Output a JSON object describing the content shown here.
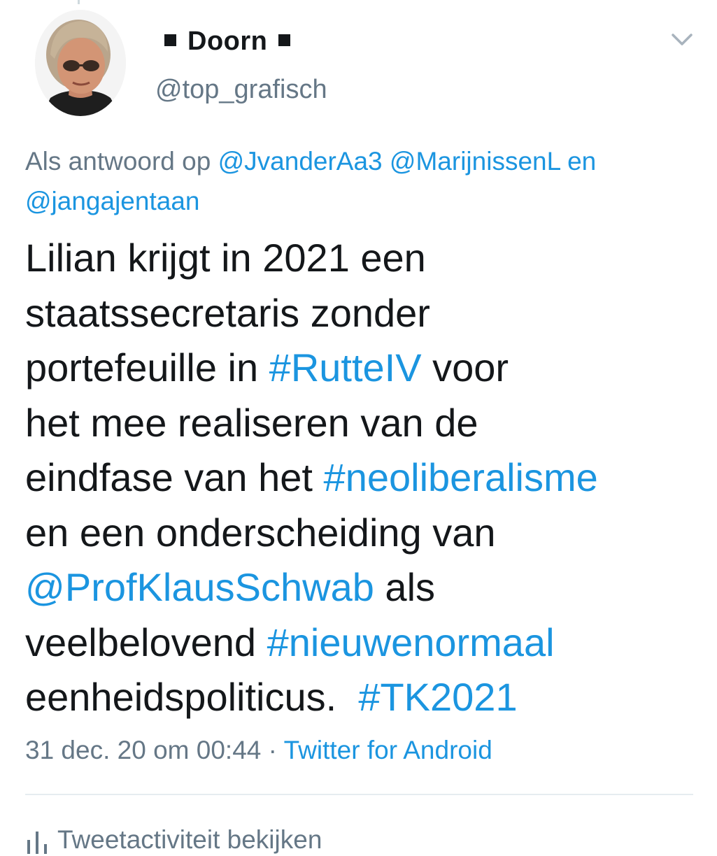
{
  "author": {
    "display_name": "Doorn",
    "handle": "@top_grafisch"
  },
  "reply_to": {
    "prefix": "Als antwoord op",
    "mentions": [
      "@JvanderAa3",
      "@MarijnissenL",
      "@jangajentaan"
    ],
    "conjunction": "en"
  },
  "tweet": {
    "line1": "Lilian krijgt in 2021 een",
    "line2": "staatssecretaris zonder",
    "line3_a": "portefeuille in ",
    "hashtag_rutte": "#RutteIV",
    "line3_b": " voor",
    "line4": "het mee realiseren van de",
    "line5_a": "eindfase van het ",
    "hashtag_neo": "#neoliberalisme",
    "line6": "en een onderscheiding van",
    "mention_schwab": "@ProfKlausSchwab",
    "line7_b": " als",
    "line8_a": "veelbelovend ",
    "hashtag_nieuw": "#nieuwenormaal",
    "line9_a": "eenheidspoliticus.  ",
    "hashtag_tk": "#TK2021"
  },
  "meta": {
    "timestamp": "31 dec. 20 om 00:44",
    "separator": "·",
    "source": "Twitter for Android"
  },
  "activity": {
    "label": "Tweetactiviteit bekijken"
  },
  "icons": {
    "chevron": "chevron-down-icon",
    "activity": "bar-chart-icon"
  },
  "colors": {
    "link": "#1b95e0",
    "text": "#14171a",
    "secondary": "#657786"
  }
}
